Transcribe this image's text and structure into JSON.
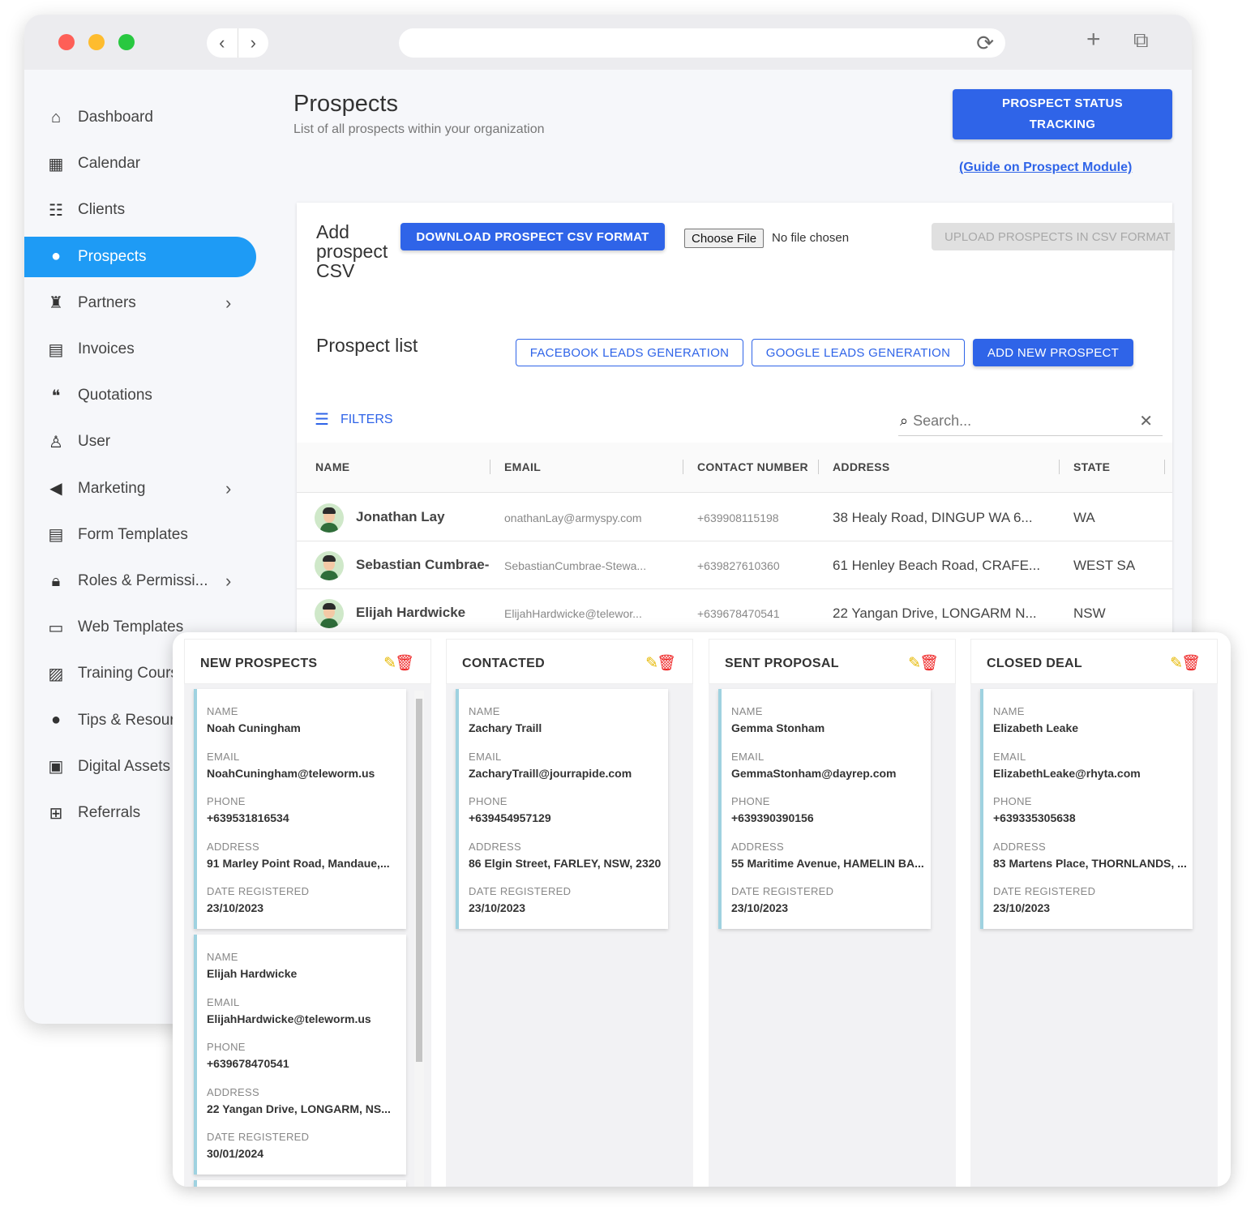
{
  "browser": {
    "back_icon": "‹",
    "forward_icon": "›",
    "reload_icon": "⟳",
    "new_tab_icon": "+",
    "tabs_icon": "⧉"
  },
  "sidebar": {
    "items": [
      {
        "label": "Dashboard",
        "icon": "home-icon",
        "glyph": "⌂"
      },
      {
        "label": "Calendar",
        "icon": "calendar-icon",
        "glyph": "▦"
      },
      {
        "label": "Clients",
        "icon": "clients-icon",
        "glyph": "☷"
      },
      {
        "label": "Prospects",
        "icon": "prospects-icon",
        "glyph": "●",
        "active": true
      },
      {
        "label": "Partners",
        "icon": "partners-icon",
        "glyph": "♜",
        "chevron": true
      },
      {
        "label": "Invoices",
        "icon": "invoice-icon",
        "glyph": "▤"
      },
      {
        "label": "Quotations",
        "icon": "quotation-icon",
        "glyph": "❝"
      },
      {
        "label": "User",
        "icon": "user-icon",
        "glyph": "♙"
      },
      {
        "label": "Marketing",
        "icon": "megaphone-icon",
        "glyph": "◀",
        "chevron": true
      },
      {
        "label": "Form Templates",
        "icon": "form-icon",
        "glyph": "▤"
      },
      {
        "label": "Roles & Permissi...",
        "icon": "lock-icon",
        "glyph": "🔒︎",
        "chevron": true
      },
      {
        "label": "Web Templates",
        "icon": "web-template-icon",
        "glyph": "▭"
      },
      {
        "label": "Training Courses",
        "icon": "training-icon",
        "glyph": "▨"
      },
      {
        "label": "Tips & Resources",
        "icon": "lightbulb-icon",
        "glyph": "●"
      },
      {
        "label": "Digital Assets",
        "icon": "image-icon",
        "glyph": "▣"
      },
      {
        "label": "Referrals",
        "icon": "referral-icon",
        "glyph": "⊞"
      }
    ],
    "chevron_glyph": "›"
  },
  "header": {
    "title": "Prospects",
    "subtitle": "List of all prospects within your organization",
    "status_button": "PROSPECT STATUS TRACKING",
    "guide_link": "(Guide on Prospect Module)"
  },
  "csv": {
    "title": "Add prospect CSV",
    "download_button": "DOWNLOAD PROSPECT CSV FORMAT",
    "choose_file": "Choose File",
    "no_file": "No file chosen",
    "upload_button": "UPLOAD PROSPECTS IN CSV FORMAT"
  },
  "list": {
    "title": "Prospect list",
    "facebook_button": "FACEBOOK LEADS GENERATION",
    "google_button": "GOOGLE LEADS GENERATION",
    "add_button": "ADD NEW PROSPECT",
    "filters_label": "FILTERS",
    "filters_glyph": "☰",
    "search_placeholder": "Search...",
    "search_glyph": "⌕",
    "clear_glyph": "✕"
  },
  "table": {
    "columns": [
      "NAME",
      "EMAIL",
      "CONTACT NUMBER",
      "ADDRESS",
      "STATE"
    ],
    "rows": [
      {
        "name": "Jonathan Lay",
        "email": "onathanLay@armyspy.com",
        "phone": "+639908115198",
        "address": "38 Healy Road, DINGUP WA 6...",
        "state": "WA"
      },
      {
        "name": "Sebastian Cumbrae-",
        "email": "SebastianCumbrae-Stewa...",
        "phone": "+639827610360",
        "address": "61 Henley Beach Road, CRAFE...",
        "state": "WEST SA"
      },
      {
        "name": "Elijah Hardwicke",
        "email": "ElijahHardwicke@telewor...",
        "phone": "+639678470541",
        "address": "22 Yangan Drive, LONGARM N...",
        "state": "NSW"
      }
    ]
  },
  "kanban": {
    "edit_glyph": "✎",
    "delete_glyph": "🗑︎",
    "labels": {
      "name": "NAME",
      "email": "EMAIL",
      "phone": "PHONE",
      "address": "ADDRESS",
      "date": "DATE REGISTERED"
    },
    "columns": [
      {
        "title": "NEW PROSPECTS",
        "cards": [
          {
            "name": "Noah Cuningham",
            "email": "NoahCuningham@teleworm.us",
            "phone": "+639531816534",
            "address": "91 Marley Point Road, Mandaue,...",
            "date": "23/10/2023"
          },
          {
            "name": "Elijah Hardwicke",
            "email": "ElijahHardwicke@teleworm.us",
            "phone": "+639678470541",
            "address": "22 Yangan Drive, LONGARM, NS...",
            "date": "30/01/2024"
          }
        ]
      },
      {
        "title": "CONTACTED",
        "cards": [
          {
            "name": "Zachary Traill",
            "email": "ZacharyTraill@jourrapide.com",
            "phone": "+639454957129",
            "address": "86 Elgin Street, FARLEY, NSW, 2320",
            "date": "23/10/2023"
          }
        ]
      },
      {
        "title": "SENT PROPOSAL",
        "cards": [
          {
            "name": "Gemma Stonham",
            "email": "GemmaStonham@dayrep.com",
            "phone": "+639390390156",
            "address": "55 Maritime Avenue, HAMELIN BA...",
            "date": "23/10/2023"
          }
        ]
      },
      {
        "title": "CLOSED DEAL",
        "cards": [
          {
            "name": "Elizabeth Leake",
            "email": "ElizabethLeake@rhyta.com",
            "phone": "+639335305638",
            "address": "83 Martens Place, THORNLANDS, ...",
            "date": "23/10/2023"
          }
        ]
      }
    ]
  }
}
